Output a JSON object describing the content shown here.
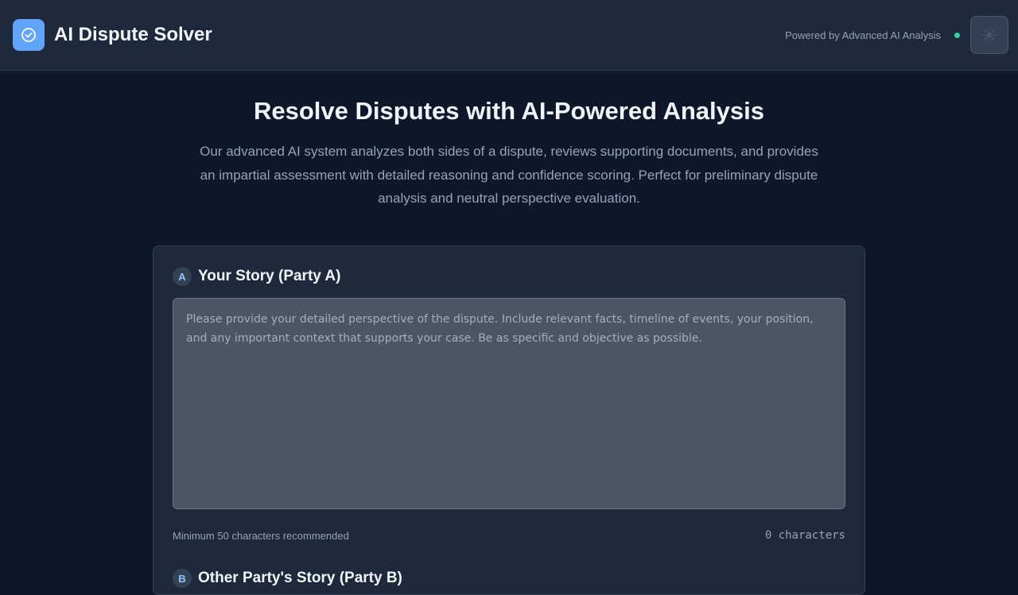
{
  "header": {
    "title": "AI Dispute Solver",
    "powered_by": "Powered by Advanced AI Analysis",
    "logo_icon": "check-circle-icon",
    "theme_icon": "sun-icon",
    "status_color": "#34d399"
  },
  "hero": {
    "title": "Resolve Disputes with AI-Powered Analysis",
    "description": "Our advanced AI system analyzes both sides of a dispute, reviews supporting documents, and provides an impartial assessment with detailed reasoning and confidence scoring. Perfect for preliminary dispute analysis and neutral perspective evaluation."
  },
  "party_a": {
    "badge": "A",
    "title": "Your Story (Party A)",
    "value": "",
    "placeholder": "Please provide your detailed perspective of the dispute. Include relevant facts, timeline of events, your position, and any important context that supports your case. Be as specific and objective as possible.",
    "hint": "Minimum 50 characters recommended",
    "char_count": "0 characters"
  },
  "party_b": {
    "badge": "B",
    "title": "Other Party's Story (Party B)"
  },
  "colors": {
    "accent": "#60a5fa",
    "background": "#0f172a",
    "card": "#1e293b"
  }
}
